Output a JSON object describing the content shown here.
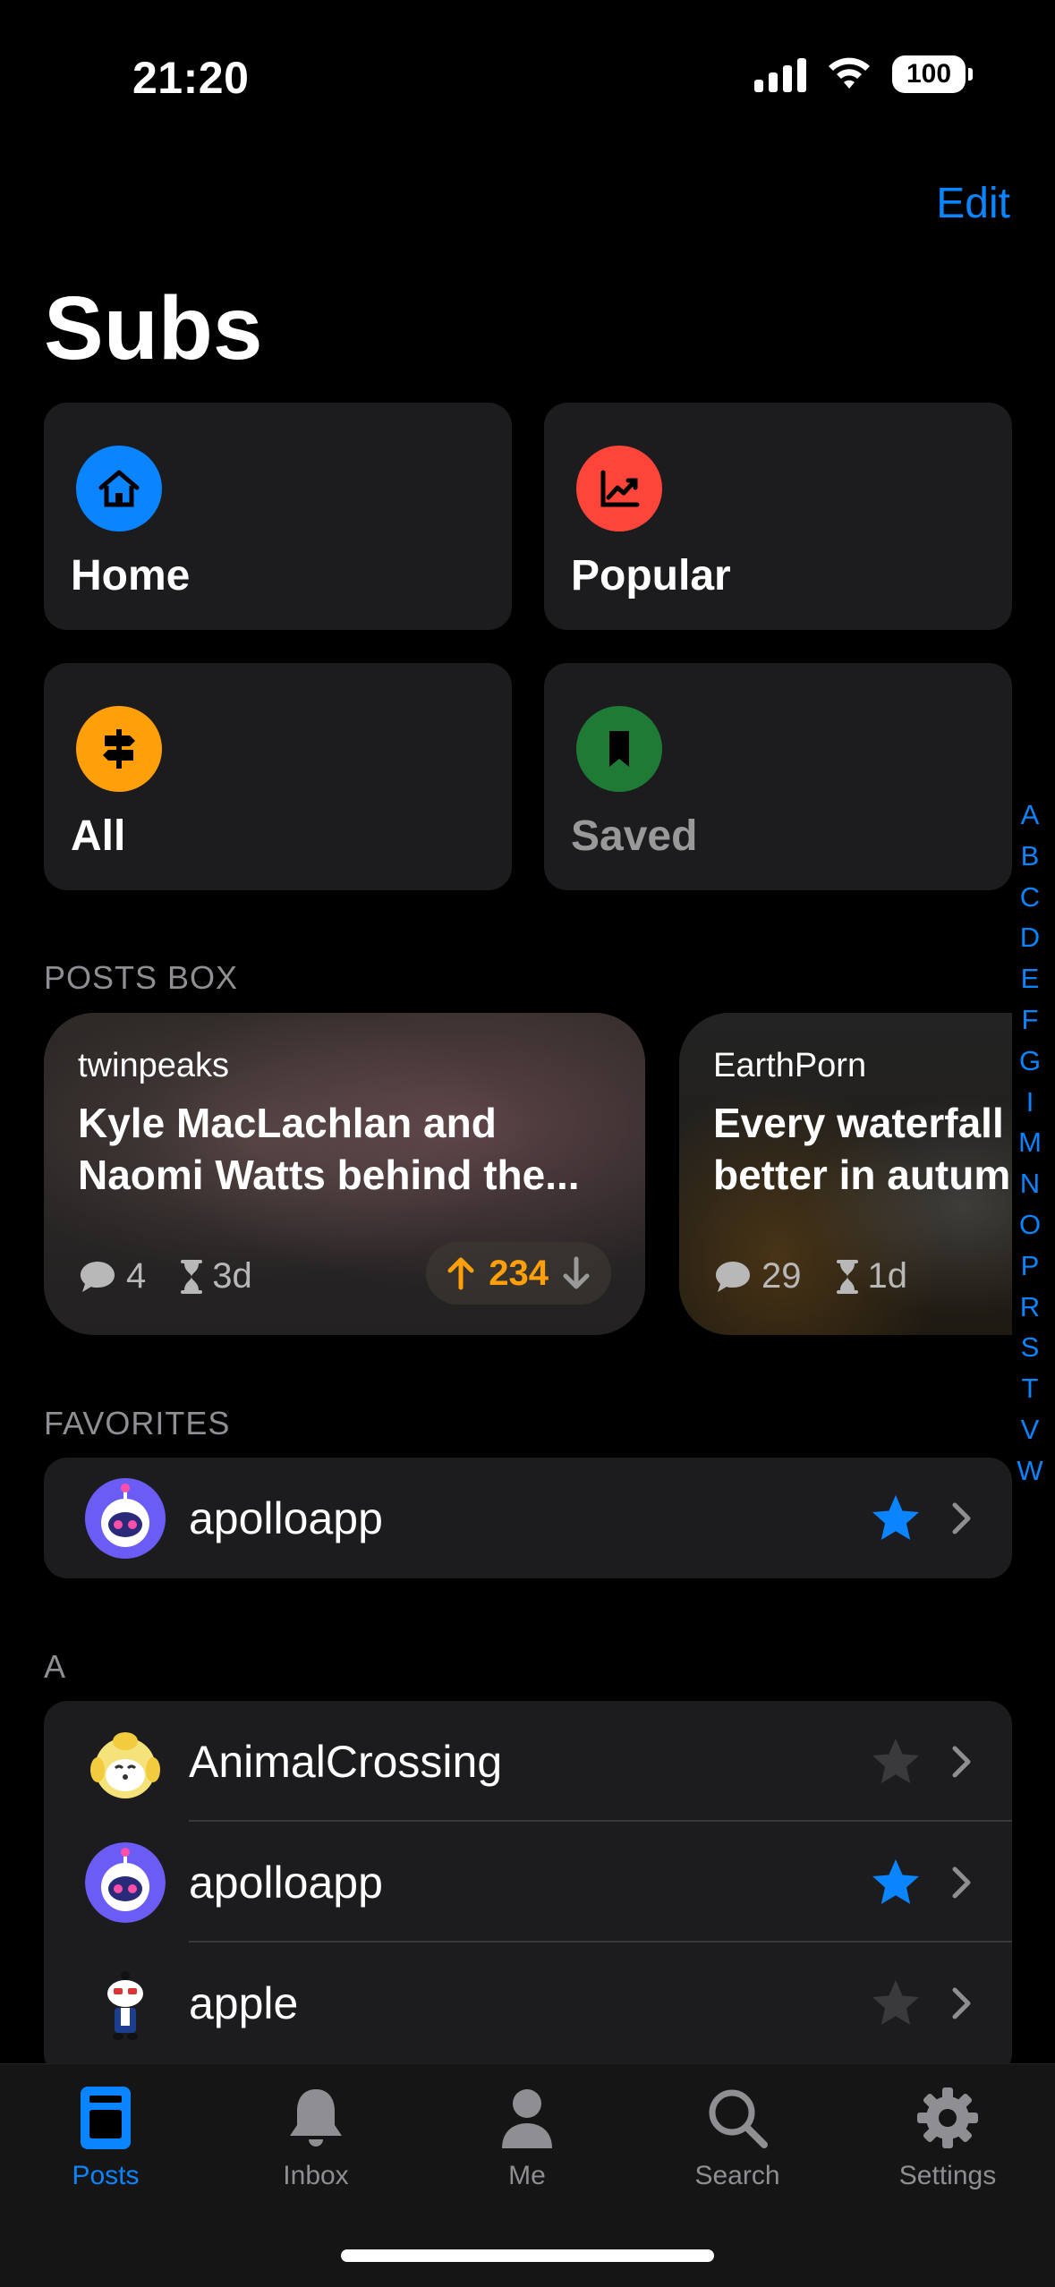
{
  "status_bar": {
    "time": "21:20",
    "battery": "100"
  },
  "header": {
    "edit_label": "Edit",
    "title": "Subs"
  },
  "tiles": [
    {
      "label": "Home",
      "icon": "home-icon",
      "color": "#0a84ff"
    },
    {
      "label": "Popular",
      "icon": "trending-icon",
      "color": "#ff453a"
    },
    {
      "label": "All",
      "icon": "signpost-icon",
      "color": "#ff9f0a"
    },
    {
      "label": "Saved",
      "icon": "bookmark-icon",
      "color": "#1f8a3a"
    }
  ],
  "posts_box": {
    "label": "POSTS BOX",
    "posts": [
      {
        "subreddit": "twinpeaks",
        "title_line1": "Kyle MacLachlan and",
        "title_line2": "Naomi Watts behind the...",
        "comments": "4",
        "age": "3d",
        "score": "234"
      },
      {
        "subreddit": "EarthPorn",
        "title_line1": "Every waterfall",
        "title_line2": "better in autum",
        "comments": "29",
        "age": "1d"
      }
    ]
  },
  "favorites": {
    "label": "FAVORITES",
    "items": [
      {
        "name": "apolloapp",
        "starred": true
      }
    ]
  },
  "section_a": {
    "label": "A",
    "items": [
      {
        "name": "AnimalCrossing",
        "starred": false
      },
      {
        "name": "apolloapp",
        "starred": true
      },
      {
        "name": "apple",
        "starred": false
      }
    ]
  },
  "index_letters": [
    "A",
    "B",
    "C",
    "D",
    "E",
    "F",
    "G",
    "I",
    "M",
    "N",
    "O",
    "P",
    "R",
    "S",
    "T",
    "V",
    "W"
  ],
  "tabs": [
    {
      "label": "Posts",
      "active": true
    },
    {
      "label": "Inbox",
      "active": false
    },
    {
      "label": "Me",
      "active": false
    },
    {
      "label": "Search",
      "active": false
    },
    {
      "label": "Settings",
      "active": false
    }
  ],
  "colors": {
    "accent": "#0a84ff",
    "upvote": "#ff9f0a",
    "card": "#1c1c1e",
    "star_off": "#3a3a3c"
  }
}
